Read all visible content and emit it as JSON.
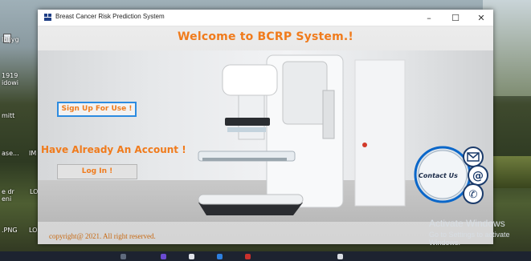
{
  "window": {
    "title": "Breast Cancer Risk Prediction System",
    "minimize_glyph": "–",
    "maximize_glyph": "☐",
    "close_glyph": "✕"
  },
  "main": {
    "heading": "Welcome to BCRP System.!",
    "signup_label": "Sign Up For Use !",
    "account_prompt": "Have Already An Account !",
    "login_label": "Log In !",
    "contact_label": "Contact Us",
    "copyright": "copyright@ 2021. All right reserved."
  },
  "desktop": {
    "labels": [
      "lbljyg",
      "1919",
      "idowi",
      "mitt",
      "ase...",
      "IM",
      "e dr",
      "LO",
      "eni",
      ".PNG",
      "LO"
    ]
  },
  "watermark": {
    "line1": "Activate Windows",
    "line2": "Go to Settings to activate Windows."
  },
  "colors": {
    "accent_orange": "#f07b1c",
    "signup_border": "#2c8be0",
    "contact_blue": "#0b67c9"
  }
}
